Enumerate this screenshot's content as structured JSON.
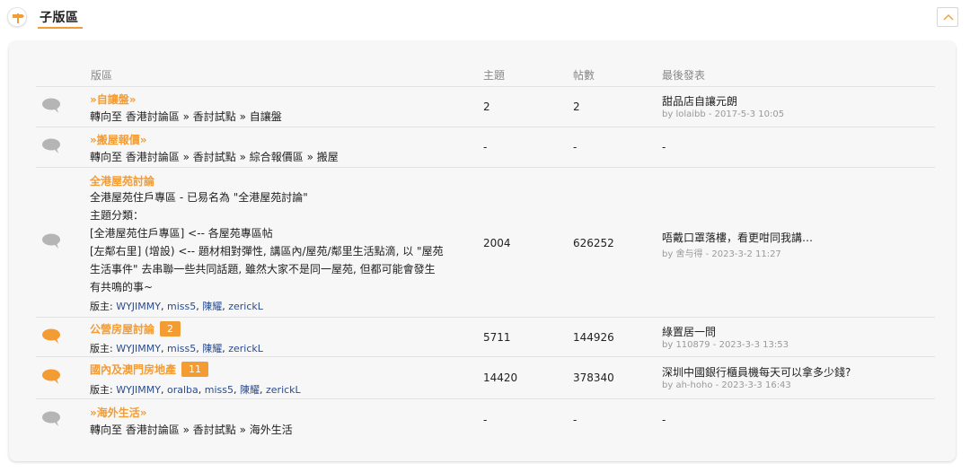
{
  "header": {
    "title": "子版區"
  },
  "columns": {
    "forum": "版區",
    "topics": "主題",
    "posts": "帖數",
    "last_post": "最後發表"
  },
  "rows": [
    {
      "name": "»自讓盤»",
      "lines": [
        "轉向至 香港討論區 » 香討試點 » 自讓盤"
      ],
      "topics": "2",
      "posts": "2",
      "last_title": "甜品店自讓元朗",
      "last_meta": "by lolaibb - 2017-5-3 10:05",
      "icon_color": "#b5b5b5"
    },
    {
      "name": "»搬屋報價»",
      "lines": [
        "轉向至 香港討論區 » 香討試點 » 綜合報價區 » 搬屋"
      ],
      "topics": "-",
      "posts": "-",
      "last_title": "-",
      "last_meta": "",
      "icon_color": "#b5b5b5"
    },
    {
      "name": "全港屋苑討論",
      "lines": [
        "全港屋苑住戶專區 - 已易名為 \"全港屋苑討論\"",
        "主題分類：",
        "[全港屋苑住戶專區] <-- 各屋苑專區帖",
        "[左鄰右里] (增設) <-- 題材相對彈性, 講區內/屋苑/鄰里生活點滴, 以 \"屋苑",
        "生活事件\" 去串聯一些共同話題, 雖然大家不是同一屋苑, 但都可能會發生",
        "有共鳴的事~"
      ],
      "mods_label": "版主: ",
      "mods": [
        "WYJIMMY",
        "miss5",
        "陳耀",
        "zerickL"
      ],
      "topics": "2004",
      "posts": "626252",
      "last_title": "唔戴口罩落樓，看更咁同我講…",
      "last_meta": "by 舍与得 - 2023-3-2 11:27",
      "icon_color": "#b5b5b5"
    },
    {
      "name": "公營房屋討論",
      "badge": "2",
      "mods_label": "版主: ",
      "mods": [
        "WYJIMMY",
        "miss5",
        "陳耀",
        "zerickL"
      ],
      "topics": "5711",
      "posts": "144926",
      "last_title": "綠置居一問",
      "last_meta": "by 110879 - 2023-3-3 13:53",
      "icon_color": "#f39c34"
    },
    {
      "name": "國內及澳門房地產",
      "badge": "11",
      "mods_label": "版主: ",
      "mods": [
        "WYJIMMY",
        "oralba",
        "miss5",
        "陳耀",
        "zerickL"
      ],
      "topics": "14420",
      "posts": "378340",
      "last_title": "深圳中國銀行櫃員機每天可以拿多少錢?",
      "last_meta": "by ah-hoho - 2023-3-3 16:43",
      "icon_color": "#f39c34"
    },
    {
      "name": "»海外生活»",
      "lines": [
        "轉向至 香港討論區 » 香討試點 » 海外生活"
      ],
      "topics": "-",
      "posts": "-",
      "last_title": "-",
      "last_meta": "",
      "icon_color": "#b5b5b5"
    }
  ]
}
